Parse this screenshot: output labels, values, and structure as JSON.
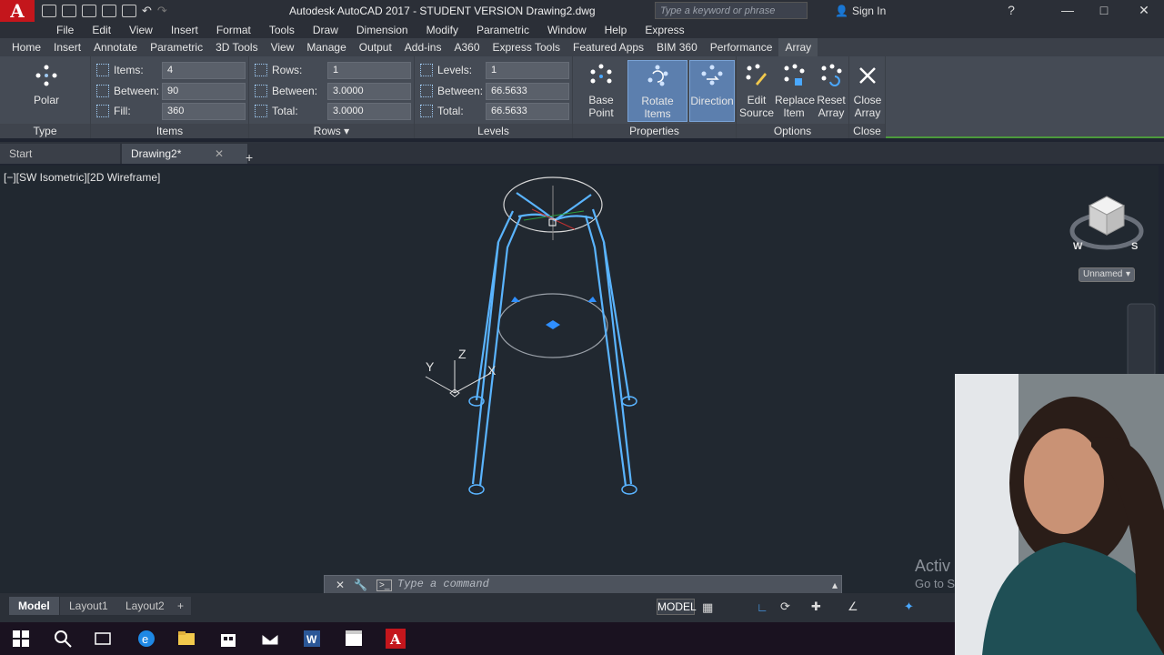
{
  "window": {
    "title": "Autodesk AutoCAD 2017 - STUDENT VERSION    Drawing2.dwg",
    "search_placeholder": "Type a keyword or phrase",
    "signin_label": "Sign In"
  },
  "menu": [
    "File",
    "Edit",
    "View",
    "Insert",
    "Format",
    "Tools",
    "Draw",
    "Dimension",
    "Modify",
    "Parametric",
    "Window",
    "Help",
    "Express"
  ],
  "ribbon_tabs": [
    "Home",
    "Insert",
    "Annotate",
    "Parametric",
    "3D Tools",
    "View",
    "Manage",
    "Output",
    "Add-ins",
    "A360",
    "Express Tools",
    "Featured Apps",
    "BIM 360",
    "Performance",
    "Array"
  ],
  "ribbon": {
    "type": {
      "button": "Polar",
      "group_label": "Type"
    },
    "items": {
      "items_label": "Items:",
      "items_value": "4",
      "between_label": "Between:",
      "between_value": "90",
      "fill_label": "Fill:",
      "fill_value": "360",
      "group_label": "Items"
    },
    "rows": {
      "rows_label": "Rows:",
      "rows_value": "1",
      "between_label": "Between:",
      "between_value": "3.0000",
      "total_label": "Total:",
      "total_value": "3.0000",
      "group_label": "Rows"
    },
    "levels": {
      "levels_label": "Levels:",
      "levels_value": "1",
      "between_label": "Between:",
      "between_value": "66.5633",
      "total_label": "Total:",
      "total_value": "66.5633",
      "group_label": "Levels"
    },
    "properties": {
      "base_point": "Base Point",
      "rotate_items": "Rotate Items",
      "direction": "Direction",
      "group_label": "Properties"
    },
    "options": {
      "edit_source_1": "Edit",
      "edit_source_2": "Source",
      "replace_item_1": "Replace",
      "replace_item_2": "Item",
      "reset_array_1": "Reset",
      "reset_array_2": "Array",
      "group_label": "Options"
    },
    "close": {
      "close_1": "Close",
      "close_2": "Array",
      "group_label": "Close"
    }
  },
  "doc_tabs": {
    "start": "Start",
    "drawing": "Drawing2*"
  },
  "viewport": {
    "label": "[−][SW Isometric][2D Wireframe]",
    "view_style": "Unnamed",
    "ucs_x": "X",
    "ucs_y": "Y",
    "ucs_z": "Z",
    "compass_w": "W",
    "compass_s": "S"
  },
  "command": {
    "placeholder": "Type a command"
  },
  "watermark": {
    "line1": "Activ",
    "line2": "Go to S"
  },
  "layout_tabs": [
    "Model",
    "Layout1",
    "Layout2"
  ],
  "status": {
    "model": "MODEL"
  },
  "colors": {
    "accent_green": "#4c9a3c",
    "selection_blue": "#4aa8ff",
    "logo_red": "#c4161c"
  }
}
